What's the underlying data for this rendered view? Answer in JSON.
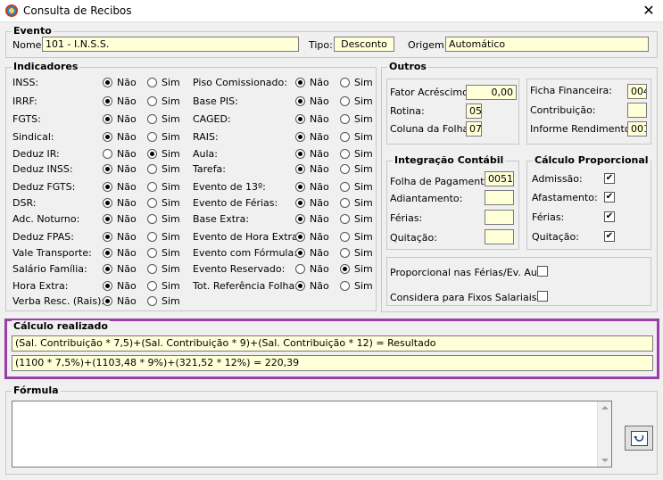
{
  "window": {
    "title": "Consulta de Recibos",
    "close_glyph": "✕"
  },
  "evento": {
    "group_label": "Evento",
    "nome_label": "Nome:",
    "nome_value": "101 - I.N.S.S.",
    "tipo_label": "Tipo:",
    "tipo_value": "Desconto",
    "origem_label": "Origem:",
    "origem_value": "Automático"
  },
  "indicadores": {
    "group_label": "Indicadores",
    "no_label": "Não",
    "yes_label": "Sim",
    "left": [
      {
        "label": "INSS:",
        "selected": "nao"
      },
      {
        "label": "IRRF:",
        "selected": "nao"
      },
      {
        "label": "FGTS:",
        "selected": "nao"
      },
      {
        "label": "Sindical:",
        "selected": "nao"
      },
      {
        "label": "Deduz IR:",
        "selected": "sim"
      },
      {
        "label": "Deduz INSS:",
        "selected": "nao"
      },
      {
        "label": "Deduz FGTS:",
        "selected": "nao"
      },
      {
        "label": "DSR:",
        "selected": "nao"
      },
      {
        "label": "Adc. Noturno:",
        "selected": "nao"
      },
      {
        "label": "Deduz FPAS:",
        "selected": "nao"
      },
      {
        "label": "Vale Transporte:",
        "selected": "nao"
      },
      {
        "label": "Salário Família:",
        "selected": "nao"
      },
      {
        "label": "Hora Extra:",
        "selected": "nao"
      },
      {
        "label": "Verba Resc. (Rais):",
        "selected": "nao"
      }
    ],
    "right": [
      {
        "label": "Piso Comissionado:",
        "selected": "nao"
      },
      {
        "label": "Base PIS:",
        "selected": "nao"
      },
      {
        "label": "CAGED:",
        "selected": "nao"
      },
      {
        "label": "RAIS:",
        "selected": "nao"
      },
      {
        "label": "Aula:",
        "selected": "nao"
      },
      {
        "label": "Tarefa:",
        "selected": "nao"
      },
      {
        "label": "Evento de 13º:",
        "selected": "nao"
      },
      {
        "label": "Evento de Férias:",
        "selected": "nao"
      },
      {
        "label": "Base Extra:",
        "selected": "nao"
      },
      {
        "label": "Evento de Hora Extra:",
        "selected": "nao"
      },
      {
        "label": "Evento com Fórmula:",
        "selected": "nao"
      },
      {
        "label": "Evento Reservado:",
        "selected": "sim"
      },
      {
        "label": "Tot. Referência Folha:",
        "selected": "nao"
      }
    ]
  },
  "outros": {
    "group_label": "Outros",
    "fator_label": "Fator Acréscimo:",
    "fator_value": "0,00",
    "rotina_label": "Rotina:",
    "rotina_value": "05",
    "coluna_label": "Coluna da Folha:",
    "coluna_value": "07",
    "ficha_label": "Ficha Financeira:",
    "ficha_value": "004",
    "contribuicao_label": "Contribuição:",
    "contribuicao_value": "",
    "informe_label": "Informe Rendimentos:",
    "informe_value": "001"
  },
  "integracao": {
    "group_label": "Integração Contábil",
    "folha_label": "Folha de Pagamento:",
    "folha_value": "0051",
    "adiantamento_label": "Adiantamento:",
    "adiantamento_value": "",
    "ferias_label": "Férias:",
    "ferias_value": "",
    "quitacao_label": "Quitação:",
    "quitacao_value": ""
  },
  "calculo_proporcional": {
    "group_label": "Cálculo Proporcional",
    "items": [
      {
        "label": "Admissão:",
        "checked": true
      },
      {
        "label": "Afastamento:",
        "checked": true
      },
      {
        "label": "Férias:",
        "checked": true
      },
      {
        "label": "Quitação:",
        "checked": true
      }
    ]
  },
  "proporcional": {
    "ferias_aula_label": "Proporcional nas Férias/Ev. Aula:",
    "ferias_aula_checked": false,
    "fixos_label": "Considera para Fixos Salariais:",
    "fixos_checked": false
  },
  "calculo_realizado": {
    "group_label": "Cálculo realizado",
    "formula_text": "(Sal. Contribuição * 7,5)+(Sal. Contribuição * 9)+(Sal. Contribuição * 12) = Resultado",
    "result_text": "(1100 * 7,5%)+(1103,48 * 9%)+(321,52 * 12%) = 220,39",
    "highlight_color": "#9b3fa8"
  },
  "formula": {
    "group_label": "Fórmula",
    "text": "",
    "undo_icon": "undo-icon"
  }
}
